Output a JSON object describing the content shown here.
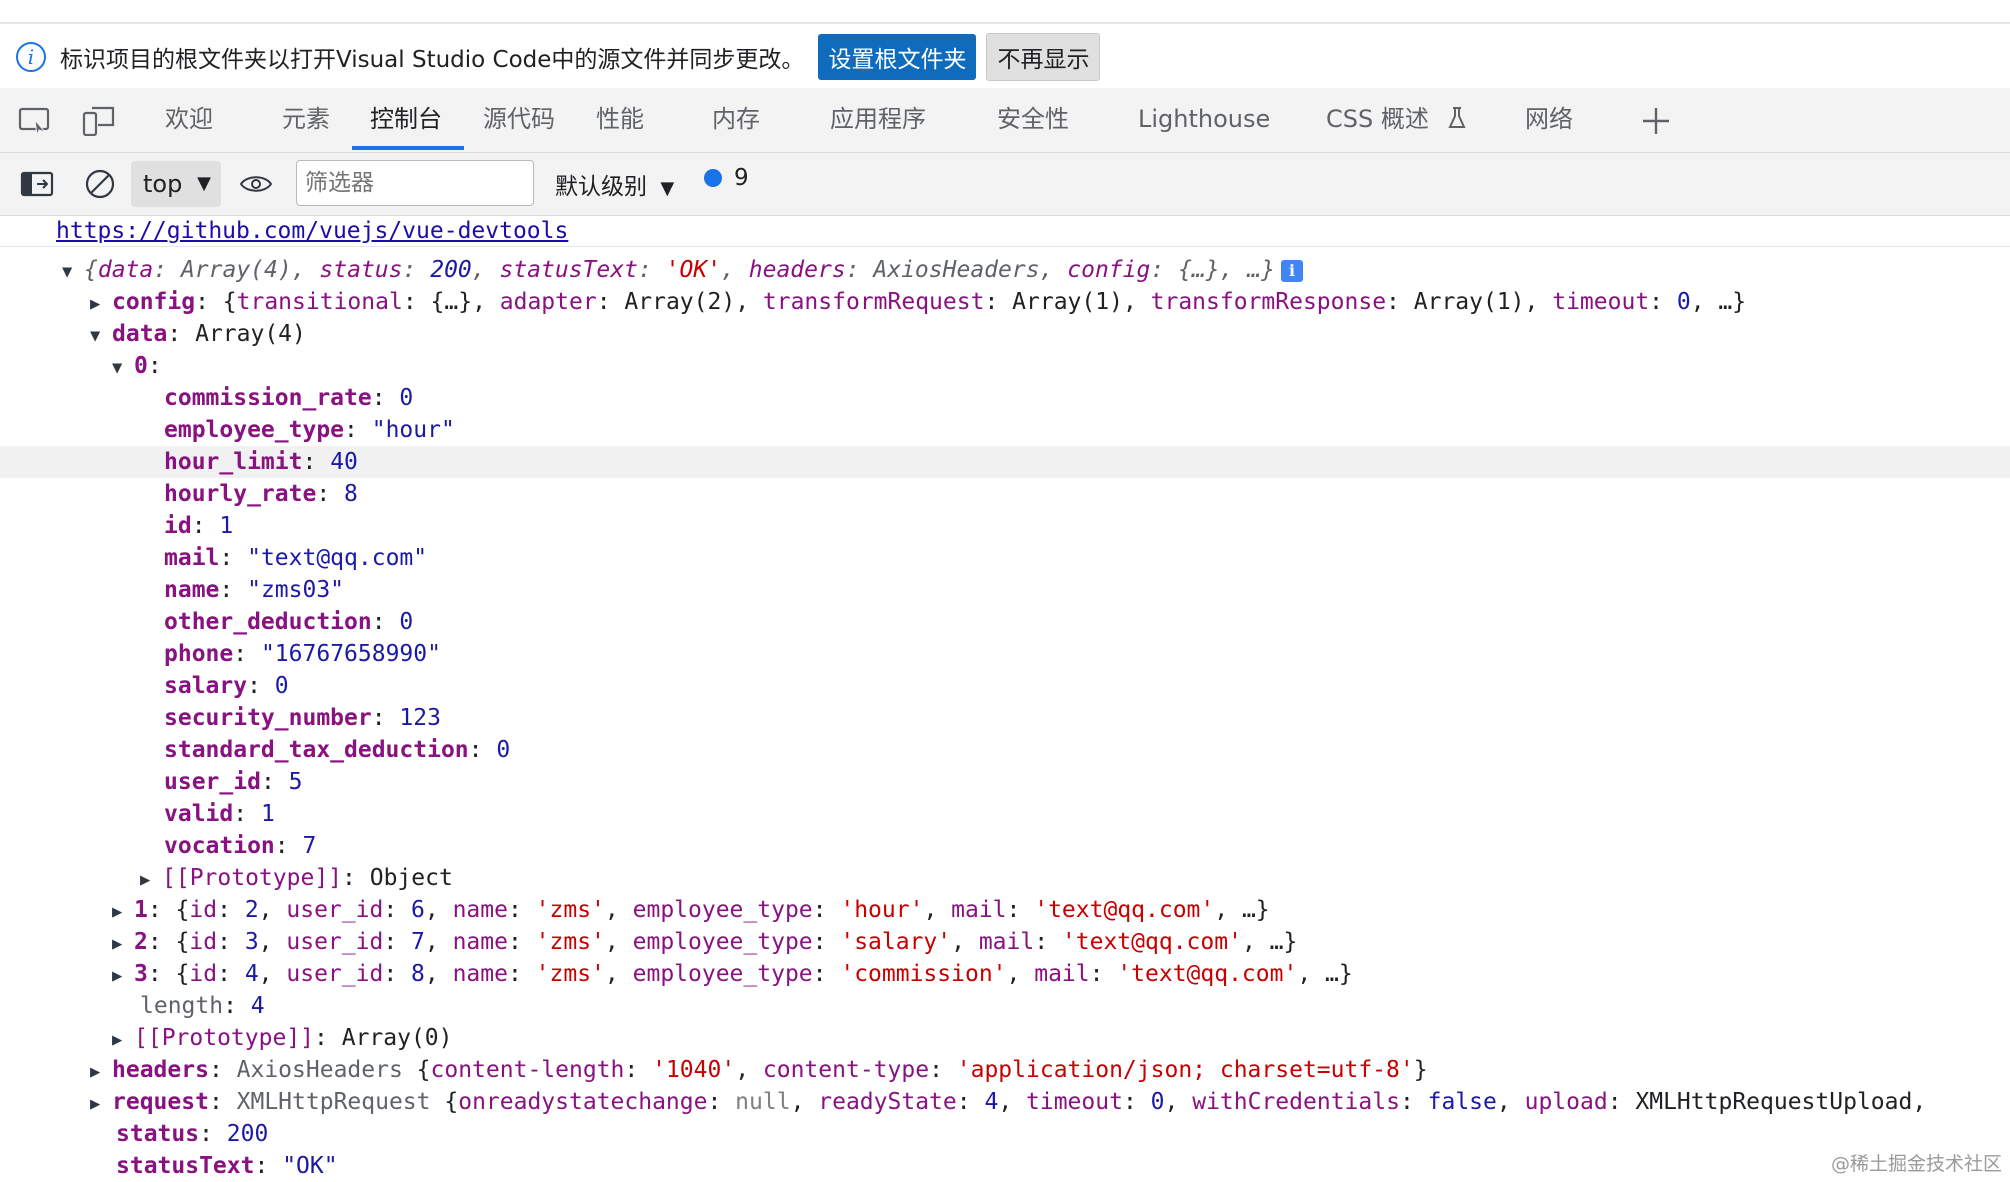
{
  "infobar": {
    "message": "标识项目的根文件夹以打开Visual Studio Code中的源文件并同步更改。",
    "set_root_button": "设置根文件夹",
    "dont_show_button": "不再显示"
  },
  "tabs": [
    {
      "label": "欢迎"
    },
    {
      "label": "元素"
    },
    {
      "label": "控制台",
      "active": true
    },
    {
      "label": "源代码"
    },
    {
      "label": "性能"
    },
    {
      "label": "内存"
    },
    {
      "label": "应用程序"
    },
    {
      "label": "安全性"
    },
    {
      "label": "Lighthouse"
    },
    {
      "label": "CSS 概述"
    },
    {
      "label": "网络"
    }
  ],
  "toolbar": {
    "context": "top",
    "filter_placeholder": "筛选器",
    "level": "默认级别",
    "issues_count": "9"
  },
  "console": {
    "link": "https://github.com/vuejs/vue-devtools",
    "summary": {
      "data": "Array(4)",
      "status": "200",
      "statusText": "'OK'",
      "headers": "AxiosHeaders",
      "config": "{…}"
    },
    "config_line": {
      "transitional": "{…}",
      "adapter": "Array(2)",
      "transformRequest": "Array(1)",
      "transformResponse": "Array(1)",
      "timeout": "0"
    },
    "data_label": "Array(4)",
    "item0": [
      {
        "key": "commission_rate",
        "value": "0",
        "type": "num"
      },
      {
        "key": "employee_type",
        "value": "\"hour\"",
        "type": "str"
      },
      {
        "key": "hour_limit",
        "value": "40",
        "type": "num"
      },
      {
        "key": "hourly_rate",
        "value": "8",
        "type": "num"
      },
      {
        "key": "id",
        "value": "1",
        "type": "num"
      },
      {
        "key": "mail",
        "value": "\"text@qq.com\"",
        "type": "str"
      },
      {
        "key": "name",
        "value": "\"zms03\"",
        "type": "str"
      },
      {
        "key": "other_deduction",
        "value": "0",
        "type": "num"
      },
      {
        "key": "phone",
        "value": "\"16767658990\"",
        "type": "str"
      },
      {
        "key": "salary",
        "value": "0",
        "type": "num"
      },
      {
        "key": "security_number",
        "value": "123",
        "type": "num"
      },
      {
        "key": "standard_tax_deduction",
        "value": "0",
        "type": "num"
      },
      {
        "key": "user_id",
        "value": "5",
        "type": "num"
      },
      {
        "key": "valid",
        "value": "1",
        "type": "num"
      },
      {
        "key": "vocation",
        "value": "7",
        "type": "num"
      }
    ],
    "item0_proto": "Object",
    "items": [
      {
        "idx": "1",
        "id": "2",
        "user_id": "6",
        "name": "'zms'",
        "employee_type": "'hour'",
        "mail": "'text@qq.com'"
      },
      {
        "idx": "2",
        "id": "3",
        "user_id": "7",
        "name": "'zms'",
        "employee_type": "'salary'",
        "mail": "'text@qq.com'"
      },
      {
        "idx": "3",
        "id": "4",
        "user_id": "8",
        "name": "'zms'",
        "employee_type": "'commission'",
        "mail": "'text@qq.com'"
      }
    ],
    "length": "4",
    "array_proto": "Array(0)",
    "headers_line": {
      "type": "AxiosHeaders",
      "content_length": "'1040'",
      "content_type": "'application/json; charset=utf-8'"
    },
    "request_line": {
      "type": "XMLHttpRequest",
      "onreadystatechange": "null",
      "readyState": "4",
      "timeout": "0",
      "withCredentials": "false",
      "upload": "XMLHttpRequestUpload"
    },
    "status": "200",
    "statusText": "\"OK\""
  },
  "watermark": "@稀土掘金技术社区"
}
